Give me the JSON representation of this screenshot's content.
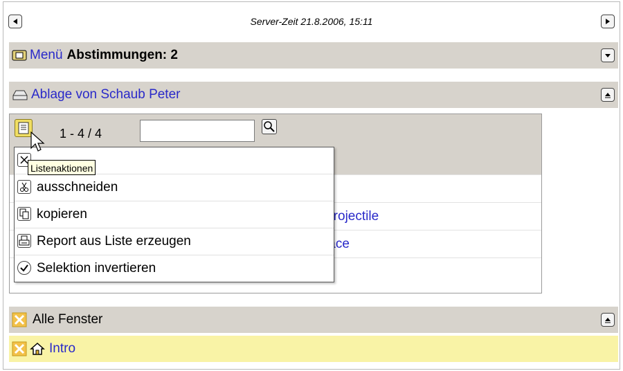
{
  "header": {
    "server_time": "Server-Zeit 21.8.2006, 15:11"
  },
  "menu_bar": {
    "menu_label": "Menü",
    "votes_label": "Abstimmungen: 2"
  },
  "ablage": {
    "title": "Ablage von Schaub Peter",
    "list_counter": "1 - 4 / 4",
    "search": {
      "value": "",
      "placeholder": ""
    },
    "rows": [
      {
        "text": ""
      },
      {
        "text": ""
      },
      {
        "text": "Projectile"
      },
      {
        "text": "face"
      }
    ]
  },
  "context_menu": {
    "items": [
      {
        "label": "...",
        "icon": "close-icon"
      },
      {
        "label": "ausschneiden",
        "icon": "scissors-icon"
      },
      {
        "label": "kopieren",
        "icon": "copy-icon"
      },
      {
        "label": "Report aus Liste erzeugen",
        "icon": "print-icon"
      },
      {
        "label": "Selektion invertieren",
        "icon": "checkmark-icon"
      }
    ]
  },
  "tooltip": {
    "text": "Listenaktionen"
  },
  "windows": {
    "title": "Alle Fenster",
    "items": [
      {
        "label": "Intro"
      }
    ]
  },
  "colors": {
    "bar": "#d7d3cc",
    "highlight": "#f9f3a6",
    "link": "#2929c9",
    "list_button": "#f0de63"
  }
}
